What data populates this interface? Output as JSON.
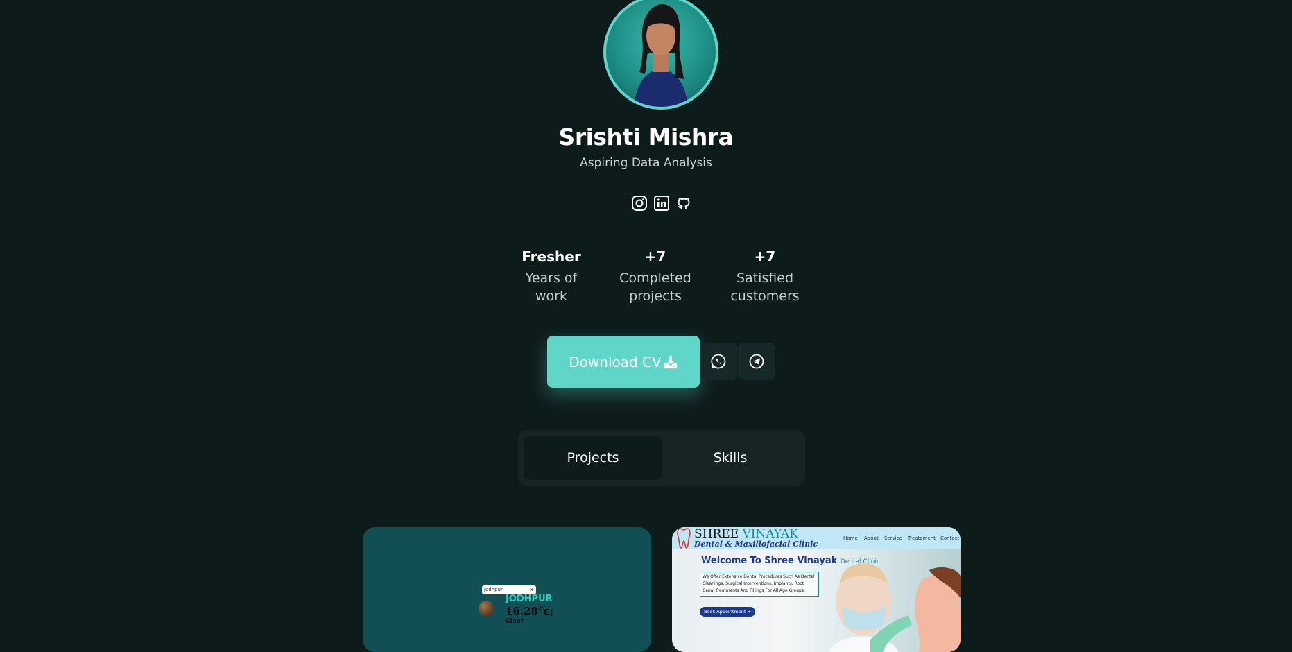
{
  "profile": {
    "name": "Srishti Mishra",
    "role": "Aspiring Data Analysis"
  },
  "socials": [
    {
      "icon": "instagram-icon"
    },
    {
      "icon": "linkedin-icon"
    },
    {
      "icon": "github-icon"
    }
  ],
  "stats": [
    {
      "value": "Fresher",
      "label_line1": "Years of",
      "label_line2": "work"
    },
    {
      "value": "+7",
      "label_line1": "Completed",
      "label_line2": "projects"
    },
    {
      "value": "+7",
      "label_line1": "Satisfied",
      "label_line2": "customers"
    }
  ],
  "actions": {
    "download_cv": "Download CV",
    "download_icon": "download-icon",
    "whatsapp_icon": "whatsapp-icon",
    "telegram_icon": "telegram-icon"
  },
  "tabs": [
    {
      "label": "Projects",
      "active": true
    },
    {
      "label": "Skills",
      "active": false
    }
  ],
  "projects": {
    "weather": {
      "search_value": "jodhpur",
      "clear_symbol": "✕",
      "city": "JODHPUR",
      "temperature": "16.28°c;",
      "condition": "Clear"
    },
    "clinic": {
      "logo_line1_a": "SHREE",
      "logo_line1_b": "VINAYAK",
      "logo_line2": "Dental & Maxillofacial Clinic",
      "nav": [
        "Home",
        "About",
        "Service",
        "Treatement",
        "Contact"
      ],
      "welcome": "Welcome To Shree Vinayak",
      "welcome_suffix": "Dental Clinic",
      "description": "We Offer Extensive Dental Procedures Such As Dental Cleanings, Surgical Interventions, Implants, Root Canal Treatments And Fillings For All Age Groups.",
      "book_button": "Book Appointment"
    }
  },
  "colors": {
    "background": "#0d1c1b",
    "accent": "#5fd6c8",
    "muted_text": "#c3cfcd",
    "panel": "#172423"
  }
}
